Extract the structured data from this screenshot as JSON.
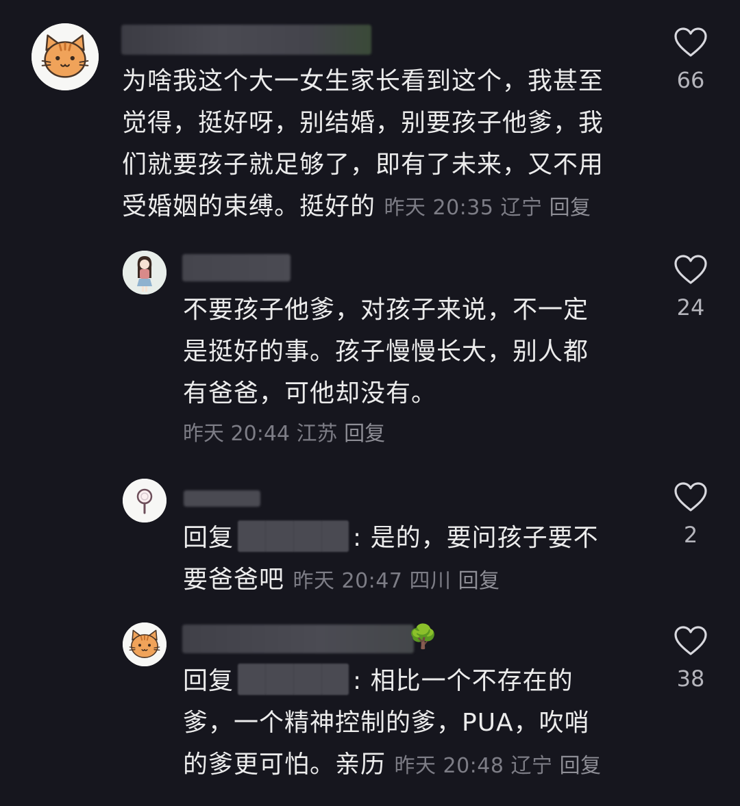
{
  "comments": [
    {
      "text": "为啥我这个大一女生家长看到这个，我甚至觉得，挺好呀，别结婚，别要孩子他爹，我们就要孩子就足够了，即有了未来，又不用受婚姻的束缚。挺好的",
      "lines": [
        "为啥我这个大一女生家长看到这个，我甚至",
        "觉得，挺好呀，别结婚，别要孩子他爹，我",
        "们就要孩子就足够了，即有了未来，又不用",
        "受婚姻的束缚。挺好的"
      ],
      "time": "昨天 20:35",
      "location": "辽宁",
      "reply_label": "回复",
      "likes": "66",
      "avatar_icon": "cat-icon"
    },
    {
      "lines": [
        "不要孩子他爹，对孩子来说，不一定",
        "是挺好的事。孩子慢慢长大，别人都",
        "有爸爸，可他却没有。"
      ],
      "time": "昨天 20:44",
      "location": "江苏",
      "reply_label": "回复",
      "likes": "24",
      "avatar_icon": "girl-illustration-icon"
    },
    {
      "reply_prefix": "回复",
      "line1_rest": ": 是的，要问孩子要不",
      "line2": "要爸爸吧",
      "time": "昨天 20:47",
      "location": "四川",
      "reply_label": "回复",
      "likes": "2",
      "avatar_icon": "magnifier-icon"
    },
    {
      "reply_prefix": "回复",
      "line1_rest": ": 相比一个不存在的",
      "line2": "爹，一个精神控制的爹，PUA，吹哨",
      "line3": "的爹更可怕。亲历",
      "time": "昨天 20:48",
      "location": "辽宁",
      "reply_label": "回复",
      "likes": "38",
      "avatar_icon": "cat-icon",
      "name_emoji": "🌳"
    }
  ],
  "colors": {
    "background": "#16161e",
    "text": "#ececec",
    "meta": "#7d7d86",
    "cat_orange": "#f0a35a"
  }
}
